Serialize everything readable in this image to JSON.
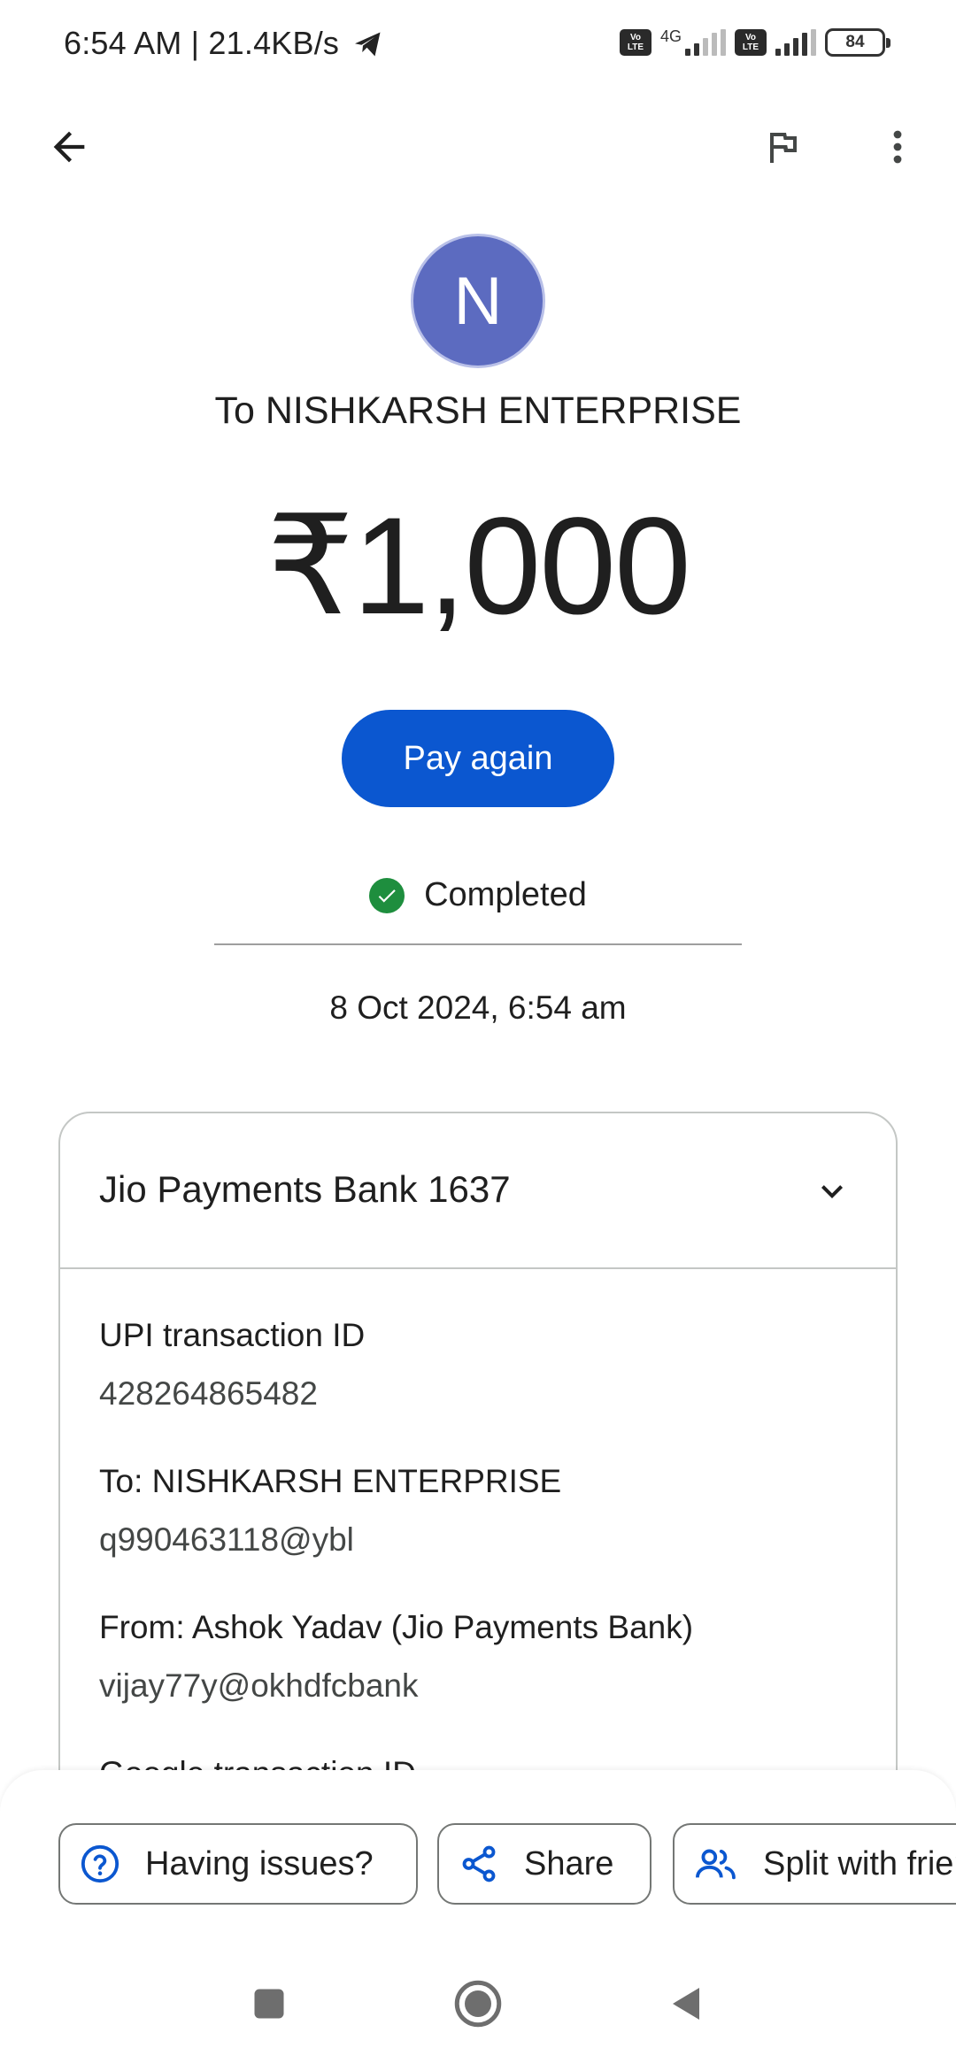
{
  "status_bar": {
    "time": "6:54 AM | 21.4KB/s",
    "network_label": "4G",
    "volte_label": "Vo LTE",
    "battery": "84"
  },
  "toolbar": {
    "back_icon": "arrow-left-icon",
    "report_icon": "flag-icon",
    "more_icon": "more-vert-icon"
  },
  "payee": {
    "avatar_letter": "N",
    "avatar_color": "#5c6bc0",
    "to_label": "To NISHKARSH ENTERPRISE"
  },
  "amount": "₹1,000",
  "actions": {
    "pay_again": "Pay again",
    "accent_color": "#0b57d0"
  },
  "transaction": {
    "status": "Completed",
    "status_color": "#1e8e3e",
    "datetime": "8 Oct 2024, 6:54 am"
  },
  "details": {
    "bank": "Jio Payments Bank 1637",
    "items": [
      {
        "label": "UPI transaction ID",
        "value": "428264865482"
      },
      {
        "label": "To: NISHKARSH ENTERPRISE",
        "value": "q990463118@ybl"
      },
      {
        "label": "From: Ashok Yadav (Jio Payments Bank)",
        "value": "vijay77y@okhdfcbank"
      },
      {
        "label": "Google transaction ID",
        "value": ""
      }
    ]
  },
  "bottom_actions": {
    "issues": "Having issues?",
    "share": "Share",
    "split": "Split with friends"
  }
}
